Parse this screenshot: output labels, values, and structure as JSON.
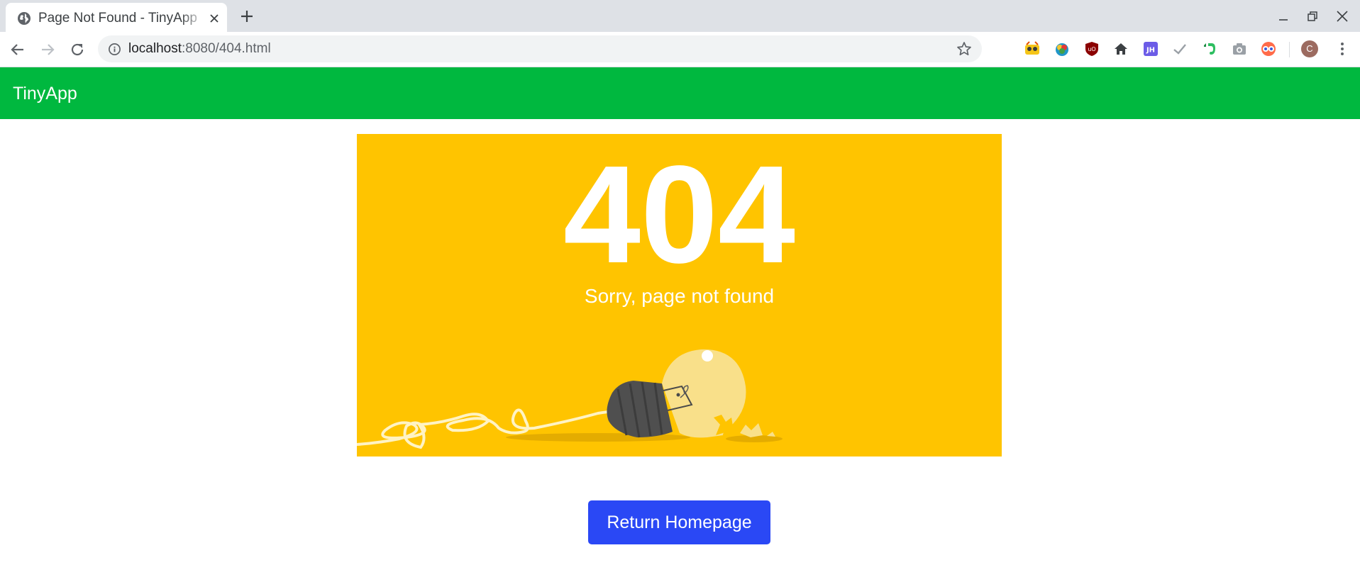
{
  "browser": {
    "tab_title": "Page Not Found - TinyApp",
    "url_host": "localhost",
    "url_rest": ":8080/404.html",
    "avatar_letter": "C",
    "extensions": [
      "tampermonkey-icon",
      "colorzilla-icon",
      "ublock-icon",
      "home-icon",
      "jsonhero-icon",
      "checkmark-icon",
      "evernote-icon",
      "camera-icon",
      "wappalyzer-icon"
    ]
  },
  "app": {
    "brand": "TinyApp",
    "accent_color": "#00b83f"
  },
  "error": {
    "code": "404",
    "message": "Sorry, page not found",
    "background_color": "#ffc400"
  },
  "actions": {
    "return_label": "Return Homepage",
    "button_color": "#2a48f5"
  }
}
